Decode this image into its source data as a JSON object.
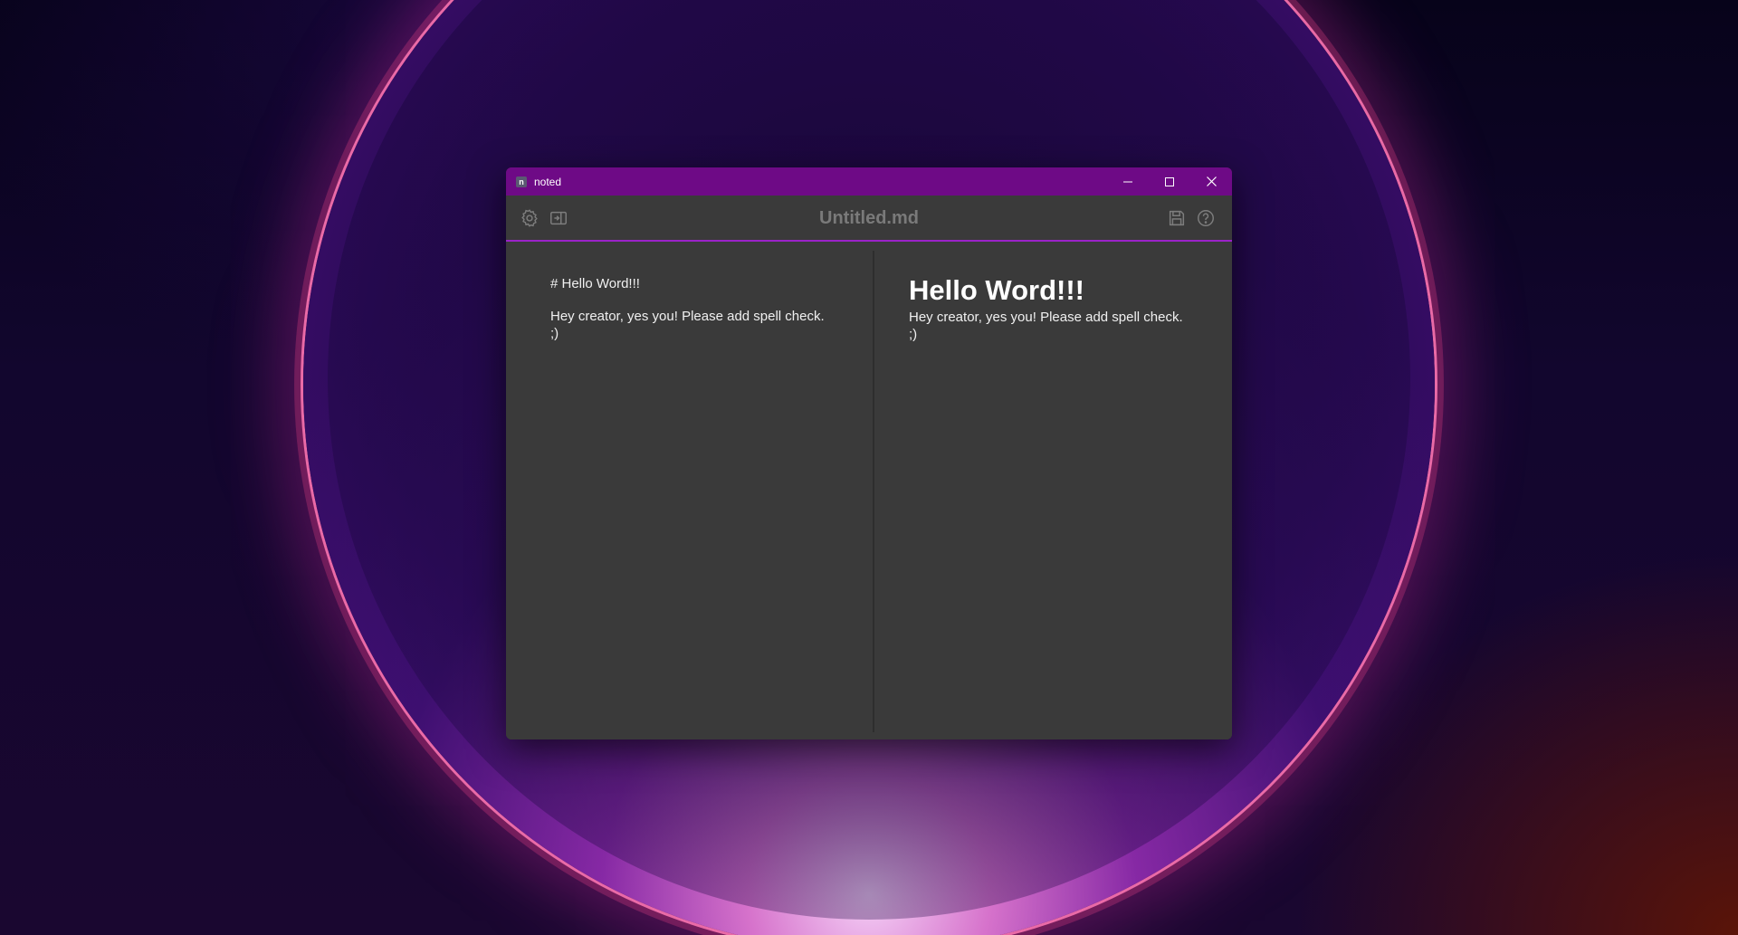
{
  "window": {
    "app_name": "noted",
    "app_icon_letter": "n"
  },
  "toolbar": {
    "document_title": "Untitled.md",
    "left_icons": [
      "gear-icon",
      "toggle-preview-icon"
    ],
    "right_icons": [
      "save-icon",
      "help-icon"
    ]
  },
  "editor": {
    "lines": [
      "# Hello Word!!!",
      "",
      "Hey creator, yes you! Please add spell check.",
      ";)"
    ]
  },
  "preview": {
    "heading": "Hello Word!!!",
    "paragraph_line1": "Hey creator, yes you! Please add spell check.",
    "paragraph_line2": ";)"
  },
  "colors": {
    "titlebar": "#6e0a86",
    "accent_border": "#9b23c8",
    "background": "#3a3a3a"
  }
}
